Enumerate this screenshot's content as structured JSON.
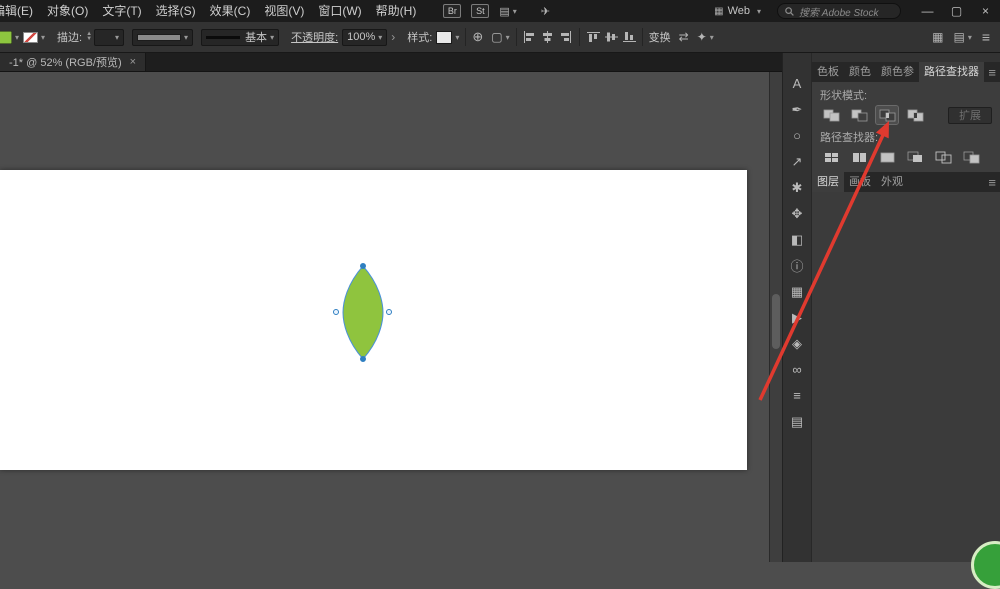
{
  "titlebar": {
    "menus": [
      "编辑(E)",
      "对象(O)",
      "文字(T)",
      "选择(S)",
      "效果(C)",
      "视图(V)",
      "窗口(W)",
      "帮助(H)"
    ],
    "bridge_badge": "Br",
    "stock_badge": "St",
    "workspace": "Web",
    "search_placeholder": "搜索 Adobe Stock",
    "minimize": "—",
    "restore": "▢",
    "close": "×"
  },
  "control_bar": {
    "fill_color": "#8dc63f",
    "stroke_label": "描边:",
    "brush_name": "基本",
    "opacity_label": "不透明度:",
    "opacity_value": "100%",
    "style_label": "样式:",
    "transform_label": "变换"
  },
  "document_tab": {
    "title": "-1* @ 52% (RGB/预览)",
    "close": "×"
  },
  "canvas": {
    "shape_fill": "#8fc43e",
    "selection_color": "#2f7fc1"
  },
  "dock": {
    "icons": [
      {
        "name": "type-panel-icon",
        "glyph": "A"
      },
      {
        "name": "pen-panel-icon",
        "glyph": "✒"
      },
      {
        "name": "ellipse-panel-icon",
        "glyph": "○"
      },
      {
        "name": "export-panel-icon",
        "glyph": "↗"
      },
      {
        "name": "brush-panel-icon",
        "glyph": "✱"
      },
      {
        "name": "swatch-panel-icon",
        "glyph": "✥"
      },
      {
        "name": "shape-builder-panel-icon",
        "glyph": "◧"
      },
      {
        "name": "info-panel-icon",
        "glyph": "ⓘ"
      },
      {
        "name": "grid-panel-icon",
        "glyph": "▦"
      },
      {
        "name": "actions-panel-icon",
        "glyph": "▶"
      },
      {
        "name": "symbols-panel-icon",
        "glyph": "◈"
      },
      {
        "name": "links-panel-icon",
        "glyph": "∞"
      },
      {
        "name": "stroke-panel-icon",
        "glyph": "≡"
      },
      {
        "name": "artboards-panel-icon",
        "glyph": "▤"
      }
    ]
  },
  "pathfinder": {
    "tabs": [
      "色板",
      "颜色",
      "颜色参",
      "路径查找器"
    ],
    "shape_modes_label": "形状模式:",
    "expand_button": "扩展",
    "pathfinders_label": "路径查找器:"
  },
  "layers": {
    "tabs": [
      "图层",
      "画板",
      "外观"
    ]
  }
}
